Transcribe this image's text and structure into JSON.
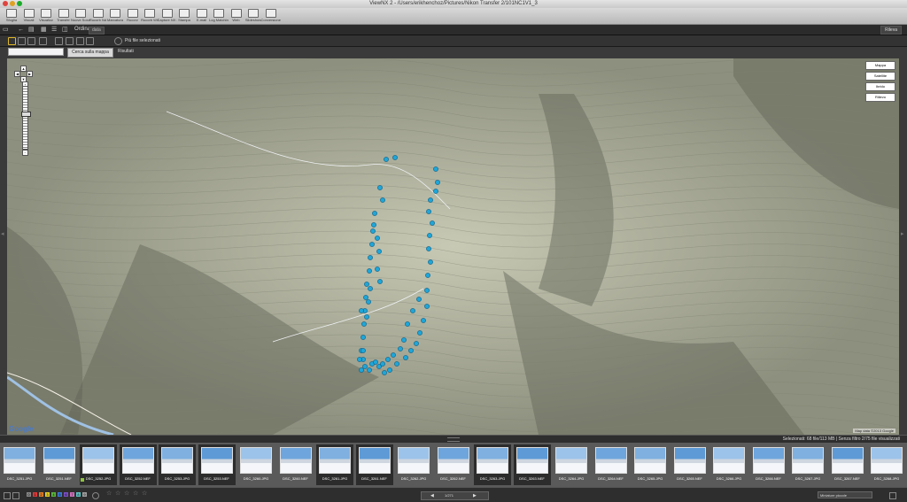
{
  "window": {
    "title": "ViewNX 2 - /Users/erikhenchoz/Pictures/Nikon Transfer 2/101NC1V1_3"
  },
  "toolbar": {
    "items": [
      "Sfoglia",
      "Visuali",
      "Visualizz",
      "Transfer",
      "Nuove Sorze",
      "Rucorb Nd",
      "Marcatura",
      "Rucorz",
      "Rucorb Wif",
      "Capture NX 2",
      "Stampa",
      "E-mail",
      "Log Matching",
      "Web",
      "Slideshow",
      "Conversione"
    ]
  },
  "navbar": {
    "sort_label": "Ordina",
    "sort_value": "data",
    "view_label": "Rileva"
  },
  "maptool": {
    "multi_label": "Più file selezionati"
  },
  "search": {
    "placeholder": "",
    "button_label": "Cerca sulla mappa",
    "results_label": "Risultati"
  },
  "map": {
    "types": [
      "Mappa",
      "Satellite",
      "Ibrido",
      "Rilievo"
    ],
    "pan_icons": [
      "▲",
      "◀",
      "▶",
      "▼"
    ],
    "zoom_in": "+",
    "zoom_out": "−",
    "google": "Google",
    "copyright": "Map data ©2013 Google",
    "marker_color": "#1fa6d8",
    "marker_count": 61
  },
  "status": {
    "text": "Selezionati: 68 file/113 MB | Senza filtro 2/75 file visualizzati"
  },
  "filmstrip": {
    "thumbs": [
      {
        "name": "DSC_3251.JPG",
        "selected": false,
        "badge": false
      },
      {
        "name": "DSC_3251.NEF",
        "selected": false,
        "badge": false
      },
      {
        "name": "DSC_3252.JPG",
        "selected": true,
        "badge": true
      },
      {
        "name": "DSC_3252.NEF",
        "selected": true,
        "badge": false
      },
      {
        "name": "DSC_3253.JPG",
        "selected": true,
        "badge": false
      },
      {
        "name": "DSC_3253.NEF",
        "selected": true,
        "badge": false
      },
      {
        "name": "DSC_3260.JPG",
        "selected": false,
        "badge": false
      },
      {
        "name": "DSC_3260.NEF",
        "selected": false,
        "badge": false
      },
      {
        "name": "DSC_3261.JPG",
        "selected": true,
        "badge": false
      },
      {
        "name": "DSC_3261.NEF",
        "selected": true,
        "badge": false
      },
      {
        "name": "DSC_3262.JPG",
        "selected": false,
        "badge": false
      },
      {
        "name": "DSC_3262.NEF",
        "selected": false,
        "badge": false
      },
      {
        "name": "DSC_3263.JPG",
        "selected": true,
        "badge": false
      },
      {
        "name": "DSC_3263.NEF",
        "selected": true,
        "badge": false
      },
      {
        "name": "DSC_3264.JPG",
        "selected": false,
        "badge": false
      },
      {
        "name": "DSC_3264.NEF",
        "selected": false,
        "badge": false
      },
      {
        "name": "DSC_3265.JPG",
        "selected": false,
        "badge": false
      },
      {
        "name": "DSC_3265.NEF",
        "selected": false,
        "badge": false
      },
      {
        "name": "DSC_3266.JPG",
        "selected": false,
        "badge": false
      },
      {
        "name": "DSC_3266.NEF",
        "selected": false,
        "badge": false
      },
      {
        "name": "DSC_3267.JPG",
        "selected": false,
        "badge": false
      },
      {
        "name": "DSC_3267.NEF",
        "selected": false,
        "badge": false
      },
      {
        "name": "DSC_3268.JPG",
        "selected": false,
        "badge": false
      }
    ]
  },
  "bottombar": {
    "labels": [
      "0",
      "1",
      "2",
      "3",
      "4",
      "5",
      "6",
      "7",
      "8",
      "9"
    ],
    "label_colors": [
      "#888888",
      "#d93a3a",
      "#e07b28",
      "#e6cf2a",
      "#5cb33d",
      "#3a7bd5",
      "#7a4fc4",
      "#cc6fb8",
      "#5fc4c4",
      "#a0a0a0"
    ],
    "stars": [
      "☆",
      "☆",
      "☆",
      "☆",
      "☆"
    ],
    "pager_prev": "◀",
    "pager_next": "▶",
    "pager_count": "1/271",
    "thumb_size": "Miniature piccole"
  }
}
